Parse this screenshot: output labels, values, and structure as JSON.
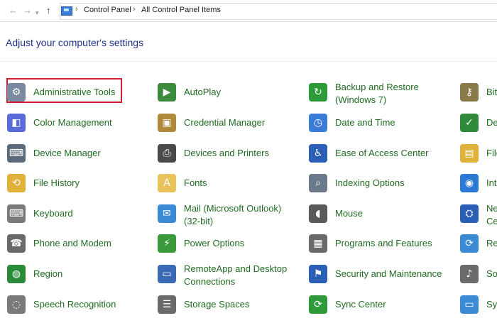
{
  "breadcrumb": {
    "root": "Control Panel",
    "current": "All Control Panel Items"
  },
  "heading": "Adjust your computer's settings",
  "items": [
    {
      "label": "Administrative Tools",
      "icon": "admin-tools-icon",
      "color": "#7a8aa0",
      "glyph": "⚙"
    },
    {
      "label": "AutoPlay",
      "icon": "autoplay-icon",
      "color": "#3c8a3c",
      "glyph": "▶"
    },
    {
      "label": "Backup and Restore (Windows 7)",
      "icon": "backup-restore-icon",
      "color": "#2f9a3a",
      "glyph": "↻"
    },
    {
      "label": "Bit",
      "icon": "bitlocker-icon",
      "color": "#8a7a4a",
      "glyph": "⚷"
    },
    {
      "label": "Color Management",
      "icon": "color-management-icon",
      "color": "#5a6ad8",
      "glyph": "◧"
    },
    {
      "label": "Credential Manager",
      "icon": "credential-manager-icon",
      "color": "#b08a3a",
      "glyph": "▣"
    },
    {
      "label": "Date and Time",
      "icon": "date-time-icon",
      "color": "#3a7bd5",
      "glyph": "◷"
    },
    {
      "label": "De",
      "icon": "default-programs-icon",
      "color": "#2f8a3a",
      "glyph": "✓"
    },
    {
      "label": "Device Manager",
      "icon": "device-manager-icon",
      "color": "#5a6a7a",
      "glyph": "⌨"
    },
    {
      "label": "Devices and Printers",
      "icon": "devices-printers-icon",
      "color": "#4a4a4a",
      "glyph": "⎙"
    },
    {
      "label": "Ease of Access Center",
      "icon": "ease-of-access-icon",
      "color": "#2a5fb5",
      "glyph": "♿"
    },
    {
      "label": "File",
      "icon": "file-explorer-options-icon",
      "color": "#e0b23a",
      "glyph": "▤"
    },
    {
      "label": "File History",
      "icon": "file-history-icon",
      "color": "#e0b23a",
      "glyph": "⟲"
    },
    {
      "label": "Fonts",
      "icon": "fonts-icon",
      "color": "#e8c25a",
      "glyph": "A"
    },
    {
      "label": "Indexing Options",
      "icon": "indexing-options-icon",
      "color": "#6a7a8a",
      "glyph": "⌕"
    },
    {
      "label": "Int",
      "icon": "internet-options-icon",
      "color": "#2a7ad5",
      "glyph": "◉"
    },
    {
      "label": "Keyboard",
      "icon": "keyboard-icon",
      "color": "#7a7a7a",
      "glyph": "⌨"
    },
    {
      "label": "Mail (Microsoft Outlook) (32-bit)",
      "icon": "mail-icon",
      "color": "#3a8ad5",
      "glyph": "✉"
    },
    {
      "label": "Mouse",
      "icon": "mouse-icon",
      "color": "#5a5a5a",
      "glyph": "◖"
    },
    {
      "label": "Ne Ce",
      "icon": "network-sharing-icon",
      "color": "#2a5fb5",
      "glyph": "⛭"
    },
    {
      "label": "Phone and Modem",
      "icon": "phone-modem-icon",
      "color": "#6a6a6a",
      "glyph": "☎"
    },
    {
      "label": "Power Options",
      "icon": "power-options-icon",
      "color": "#3a9a3a",
      "glyph": "⚡"
    },
    {
      "label": "Programs and Features",
      "icon": "programs-features-icon",
      "color": "#6a6a6a",
      "glyph": "▦"
    },
    {
      "label": "Re",
      "icon": "recovery-icon",
      "color": "#3a8ad5",
      "glyph": "⟳"
    },
    {
      "label": "Region",
      "icon": "region-icon",
      "color": "#2a8a3a",
      "glyph": "◍"
    },
    {
      "label": "RemoteApp and Desktop Connections",
      "icon": "remoteapp-icon",
      "color": "#3a6ab5",
      "glyph": "▭"
    },
    {
      "label": "Security and Maintenance",
      "icon": "security-maintenance-icon",
      "color": "#2a5fb5",
      "glyph": "⚑"
    },
    {
      "label": "So",
      "icon": "sound-icon",
      "color": "#6a6a6a",
      "glyph": "♪"
    },
    {
      "label": "Speech Recognition",
      "icon": "speech-recognition-icon",
      "color": "#7a7a7a",
      "glyph": "◌"
    },
    {
      "label": "Storage Spaces",
      "icon": "storage-spaces-icon",
      "color": "#6a6a6a",
      "glyph": "☰"
    },
    {
      "label": "Sync Center",
      "icon": "sync-center-icon",
      "color": "#2f9a3a",
      "glyph": "⟳"
    },
    {
      "label": "Sy",
      "icon": "system-icon",
      "color": "#3a8ad5",
      "glyph": "▭"
    }
  ]
}
